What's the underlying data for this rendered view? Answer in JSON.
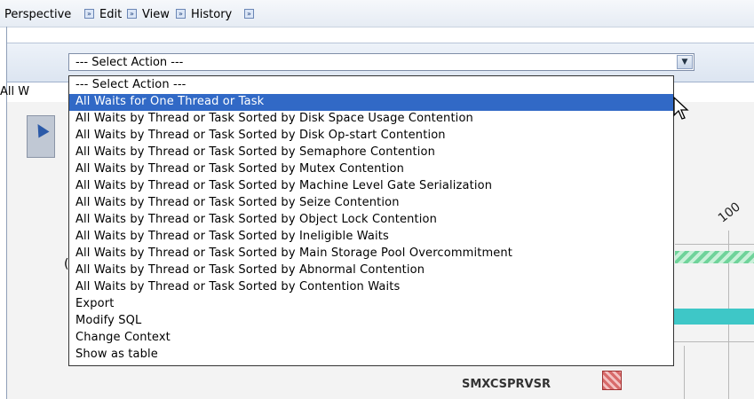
{
  "menubar": {
    "items": [
      "Perspective",
      "Edit",
      "View",
      "History"
    ],
    "arrow_glyph": "»"
  },
  "action_select": {
    "value": "--- Select Action ---",
    "options": [
      "--- Select Action ---",
      "All Waits for One Thread or Task",
      "All Waits by Thread or Task Sorted by Disk Space Usage Contention",
      "All Waits by Thread or Task Sorted by Disk Op-start Contention",
      "All Waits by Thread or Task Sorted by Semaphore Contention",
      "All Waits by Thread or Task Sorted by Mutex Contention",
      "All Waits by Thread or Task Sorted by Machine Level Gate Serialization",
      "All Waits by Thread or Task Sorted by Seize Contention",
      "All Waits by Thread or Task Sorted by Object Lock Contention",
      "All Waits by Thread or Task Sorted by Ineligible Waits",
      "All Waits by Thread or Task Sorted by Main Storage Pool Overcommitment",
      "All Waits by Thread or Task Sorted by Abnormal Contention",
      "All Waits by Thread or Task Sorted by Contention Waits",
      "Export",
      "Modify SQL",
      "Change Context",
      "Show as table"
    ],
    "highlighted_index": 1,
    "highlight_color": "#3169c6"
  },
  "tab": {
    "label": "All W"
  },
  "chart": {
    "axis_tick": "100",
    "row_label": "SMXCSPRVSR",
    "partial_label": "("
  }
}
